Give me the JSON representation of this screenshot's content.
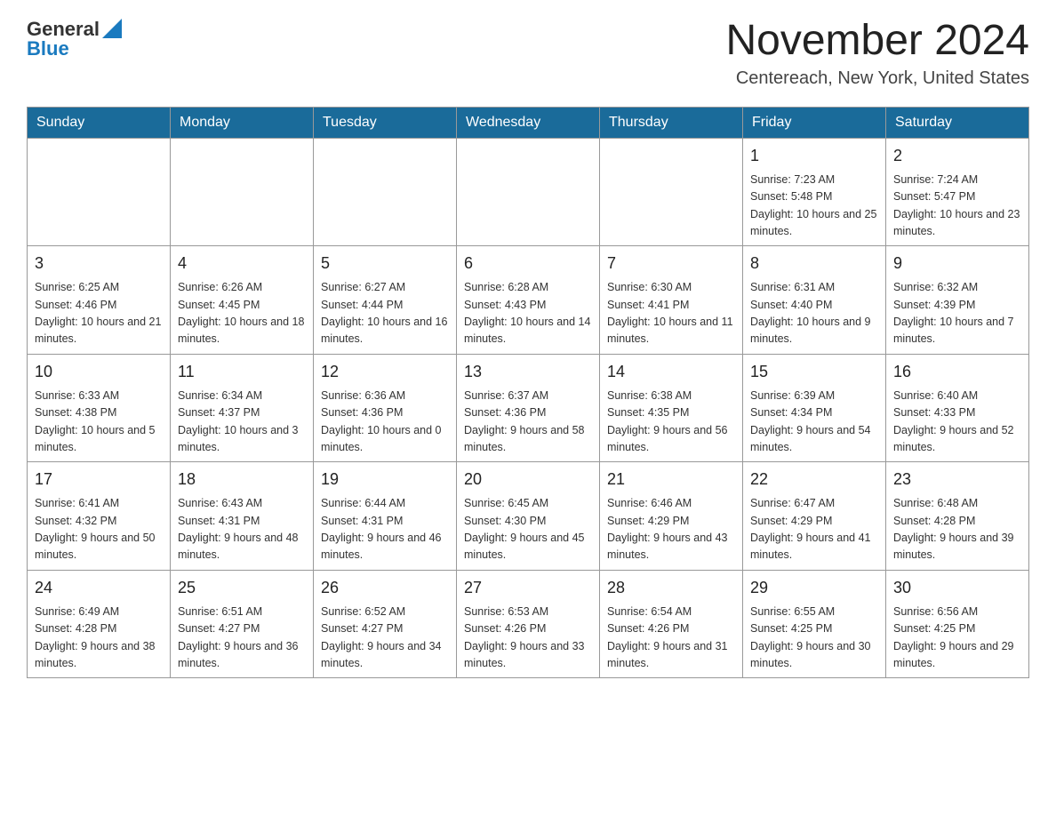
{
  "header": {
    "logo_general": "General",
    "logo_blue": "Blue",
    "month_title": "November 2024",
    "location": "Centereach, New York, United States"
  },
  "days_of_week": [
    "Sunday",
    "Monday",
    "Tuesday",
    "Wednesday",
    "Thursday",
    "Friday",
    "Saturday"
  ],
  "weeks": [
    {
      "days": [
        {
          "number": "",
          "info": ""
        },
        {
          "number": "",
          "info": ""
        },
        {
          "number": "",
          "info": ""
        },
        {
          "number": "",
          "info": ""
        },
        {
          "number": "",
          "info": ""
        },
        {
          "number": "1",
          "info": "Sunrise: 7:23 AM\nSunset: 5:48 PM\nDaylight: 10 hours and 25 minutes."
        },
        {
          "number": "2",
          "info": "Sunrise: 7:24 AM\nSunset: 5:47 PM\nDaylight: 10 hours and 23 minutes."
        }
      ]
    },
    {
      "days": [
        {
          "number": "3",
          "info": "Sunrise: 6:25 AM\nSunset: 4:46 PM\nDaylight: 10 hours and 21 minutes."
        },
        {
          "number": "4",
          "info": "Sunrise: 6:26 AM\nSunset: 4:45 PM\nDaylight: 10 hours and 18 minutes."
        },
        {
          "number": "5",
          "info": "Sunrise: 6:27 AM\nSunset: 4:44 PM\nDaylight: 10 hours and 16 minutes."
        },
        {
          "number": "6",
          "info": "Sunrise: 6:28 AM\nSunset: 4:43 PM\nDaylight: 10 hours and 14 minutes."
        },
        {
          "number": "7",
          "info": "Sunrise: 6:30 AM\nSunset: 4:41 PM\nDaylight: 10 hours and 11 minutes."
        },
        {
          "number": "8",
          "info": "Sunrise: 6:31 AM\nSunset: 4:40 PM\nDaylight: 10 hours and 9 minutes."
        },
        {
          "number": "9",
          "info": "Sunrise: 6:32 AM\nSunset: 4:39 PM\nDaylight: 10 hours and 7 minutes."
        }
      ]
    },
    {
      "days": [
        {
          "number": "10",
          "info": "Sunrise: 6:33 AM\nSunset: 4:38 PM\nDaylight: 10 hours and 5 minutes."
        },
        {
          "number": "11",
          "info": "Sunrise: 6:34 AM\nSunset: 4:37 PM\nDaylight: 10 hours and 3 minutes."
        },
        {
          "number": "12",
          "info": "Sunrise: 6:36 AM\nSunset: 4:36 PM\nDaylight: 10 hours and 0 minutes."
        },
        {
          "number": "13",
          "info": "Sunrise: 6:37 AM\nSunset: 4:36 PM\nDaylight: 9 hours and 58 minutes."
        },
        {
          "number": "14",
          "info": "Sunrise: 6:38 AM\nSunset: 4:35 PM\nDaylight: 9 hours and 56 minutes."
        },
        {
          "number": "15",
          "info": "Sunrise: 6:39 AM\nSunset: 4:34 PM\nDaylight: 9 hours and 54 minutes."
        },
        {
          "number": "16",
          "info": "Sunrise: 6:40 AM\nSunset: 4:33 PM\nDaylight: 9 hours and 52 minutes."
        }
      ]
    },
    {
      "days": [
        {
          "number": "17",
          "info": "Sunrise: 6:41 AM\nSunset: 4:32 PM\nDaylight: 9 hours and 50 minutes."
        },
        {
          "number": "18",
          "info": "Sunrise: 6:43 AM\nSunset: 4:31 PM\nDaylight: 9 hours and 48 minutes."
        },
        {
          "number": "19",
          "info": "Sunrise: 6:44 AM\nSunset: 4:31 PM\nDaylight: 9 hours and 46 minutes."
        },
        {
          "number": "20",
          "info": "Sunrise: 6:45 AM\nSunset: 4:30 PM\nDaylight: 9 hours and 45 minutes."
        },
        {
          "number": "21",
          "info": "Sunrise: 6:46 AM\nSunset: 4:29 PM\nDaylight: 9 hours and 43 minutes."
        },
        {
          "number": "22",
          "info": "Sunrise: 6:47 AM\nSunset: 4:29 PM\nDaylight: 9 hours and 41 minutes."
        },
        {
          "number": "23",
          "info": "Sunrise: 6:48 AM\nSunset: 4:28 PM\nDaylight: 9 hours and 39 minutes."
        }
      ]
    },
    {
      "days": [
        {
          "number": "24",
          "info": "Sunrise: 6:49 AM\nSunset: 4:28 PM\nDaylight: 9 hours and 38 minutes."
        },
        {
          "number": "25",
          "info": "Sunrise: 6:51 AM\nSunset: 4:27 PM\nDaylight: 9 hours and 36 minutes."
        },
        {
          "number": "26",
          "info": "Sunrise: 6:52 AM\nSunset: 4:27 PM\nDaylight: 9 hours and 34 minutes."
        },
        {
          "number": "27",
          "info": "Sunrise: 6:53 AM\nSunset: 4:26 PM\nDaylight: 9 hours and 33 minutes."
        },
        {
          "number": "28",
          "info": "Sunrise: 6:54 AM\nSunset: 4:26 PM\nDaylight: 9 hours and 31 minutes."
        },
        {
          "number": "29",
          "info": "Sunrise: 6:55 AM\nSunset: 4:25 PM\nDaylight: 9 hours and 30 minutes."
        },
        {
          "number": "30",
          "info": "Sunrise: 6:56 AM\nSunset: 4:25 PM\nDaylight: 9 hours and 29 minutes."
        }
      ]
    }
  ]
}
